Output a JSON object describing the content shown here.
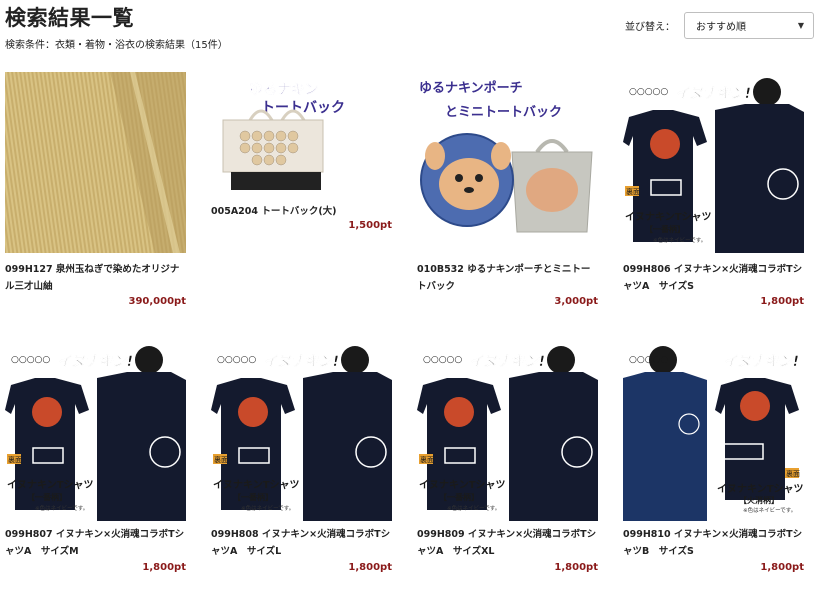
{
  "page": {
    "title": "検索結果一覧",
    "condition": "検索条件：衣類・着物・浴衣の検索結果（15件）"
  },
  "sort": {
    "label": "並び替え：",
    "selected": "おすすめ順"
  },
  "products": [
    {
      "name": "099H127 泉州玉ねぎで染めたオリジナル三才山紬",
      "price": "390,000pt",
      "image": "fabric-roll"
    },
    {
      "name": "005A204 トートバック(大)",
      "price": "1,500pt",
      "image": "tote-bag",
      "banner": [
        "ゆるナキン",
        "トートバック"
      ]
    },
    {
      "name": "010B532 ゆるナキンポーチとミニトートバック",
      "price": "3,000pt",
      "image": "pouch-and-tote",
      "banner": [
        "ゆるナキンポーチ",
        "とミニトートバック"
      ]
    },
    {
      "name": "099H806 イヌナキン×火消魂コラボTシャツA　サイズS",
      "price": "1,800pt",
      "image": "tshirt-a",
      "logo": "イヌナキン!",
      "back_label": "裏面",
      "caption": "イヌナキンTシャツ",
      "sub": "【一番柄】",
      "note": "※色はネイビーです。"
    },
    {
      "name": "099H807 イヌナキン×火消魂コラボTシャツA　サイズM",
      "price": "1,800pt",
      "image": "tshirt-a",
      "logo": "イヌナキン!",
      "back_label": "裏面",
      "caption": "イヌナキンTシャツ",
      "sub": "【一番柄】",
      "note": "※色はネイビーです。"
    },
    {
      "name": "099H808 イヌナキン×火消魂コラボTシャツA　サイズL",
      "price": "1,800pt",
      "image": "tshirt-a",
      "logo": "イヌナキン!",
      "back_label": "裏面",
      "caption": "イヌナキンTシャツ",
      "sub": "【一番柄】",
      "note": "※色はネイビーです。"
    },
    {
      "name": "099H809 イヌナキン×火消魂コラボTシャツA　サイズXL",
      "price": "1,800pt",
      "image": "tshirt-a",
      "logo": "イヌナキン!",
      "back_label": "裏面",
      "caption": "イヌナキンTシャツ",
      "sub": "【一番柄】",
      "note": "※色はネイビーです。"
    },
    {
      "name": "099H810 イヌナキン×火消魂コラボTシャツB　サイズS",
      "price": "1,800pt",
      "image": "tshirt-b",
      "logo": "イヌナキン!",
      "back_label": "裏面",
      "caption": "イヌナキンTシャツ",
      "sub": "【火消柄】",
      "note": "※色はネイビーです。"
    }
  ]
}
